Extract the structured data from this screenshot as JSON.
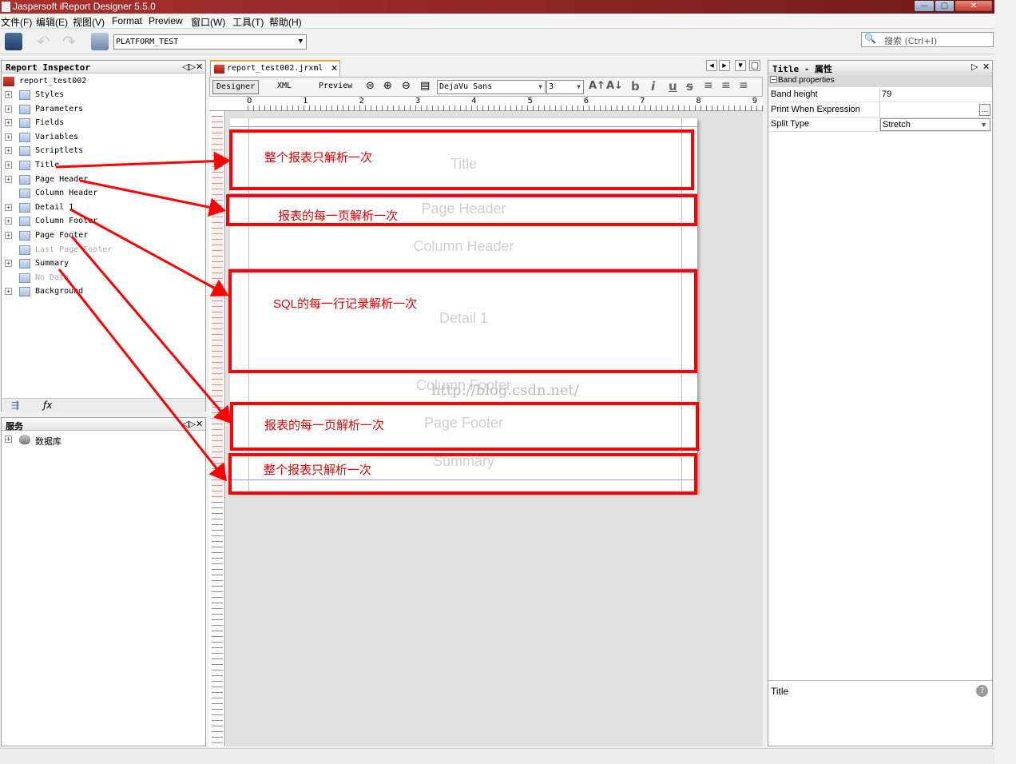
{
  "window": {
    "title": "Jaspersoft iReport Designer 5.5.0",
    "min": "—",
    "max": "▢",
    "close": "✕"
  },
  "menu": [
    "文件(F)",
    "编辑(E)",
    "视图(V)",
    "Format",
    "Preview",
    "窗口(W)",
    "工具(T)",
    "帮助(H)"
  ],
  "toolbar": {
    "datasource": "PLATFORM_TEST",
    "search_placeholder": "搜索 (Ctrl+I)"
  },
  "inspector": {
    "title": "Report Inspector",
    "root": "report_test002",
    "items": [
      {
        "label": "Styles",
        "expandable": true,
        "disabled": false
      },
      {
        "label": "Parameters",
        "expandable": true,
        "disabled": false
      },
      {
        "label": "Fields",
        "expandable": true,
        "disabled": false
      },
      {
        "label": "Variables",
        "expandable": true,
        "disabled": false
      },
      {
        "label": "Scriptlets",
        "expandable": true,
        "disabled": false
      },
      {
        "label": "Title",
        "expandable": true,
        "disabled": false
      },
      {
        "label": "Page Header",
        "expandable": true,
        "disabled": false
      },
      {
        "label": "Column Header",
        "expandable": false,
        "disabled": false
      },
      {
        "label": "Detail 1",
        "expandable": true,
        "disabled": false
      },
      {
        "label": "Column Footer",
        "expandable": true,
        "disabled": false
      },
      {
        "label": "Page Footer",
        "expandable": true,
        "disabled": false
      },
      {
        "label": "Last Page Footer",
        "expandable": false,
        "disabled": true
      },
      {
        "label": "Summary",
        "expandable": true,
        "disabled": false
      },
      {
        "label": "No Data",
        "expandable": false,
        "disabled": true
      },
      {
        "label": "Background",
        "expandable": true,
        "disabled": false
      }
    ]
  },
  "services": {
    "title": "服务",
    "items": [
      "数据库"
    ]
  },
  "editor": {
    "file_tab": "report_test002.jrxml",
    "view_tabs": [
      "Designer",
      "XML",
      "Preview"
    ],
    "font": "DejaVu Sans",
    "font_size": "3",
    "ruler_labels": [
      "0",
      "1",
      "2",
      "3",
      "4",
      "5",
      "6",
      "7",
      "8",
      "9"
    ],
    "bands": [
      "Title",
      "Page Header",
      "Column Header",
      "Detail 1",
      "Column Footer",
      "Page Footer",
      "Summary"
    ],
    "watermark": "http://blog.csdn.net/"
  },
  "annotations": {
    "title": "整个报表只解析一次",
    "page_header": "报表的每一页解析一次",
    "detail": "SQL的每一行记录解析一次",
    "page_footer": "报表的每一页解析一次",
    "summary": "整个报表只解析一次"
  },
  "properties": {
    "title": "Title - 属性",
    "section": "Band properties",
    "rows": [
      {
        "key": "Band height",
        "value": "79"
      },
      {
        "key": "Print When Expression",
        "value": ""
      },
      {
        "key": "Split Type",
        "value": "Stretch"
      }
    ],
    "help_title": "Title"
  },
  "colors": {
    "annotation": "#ff0000",
    "titlebar": "#8a2523"
  }
}
